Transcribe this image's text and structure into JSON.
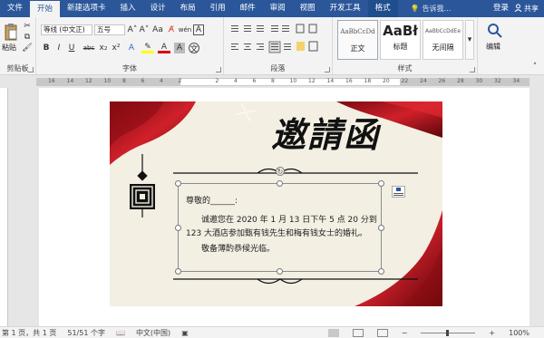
{
  "tabs": [
    "文件",
    "开始",
    "新建选项卡",
    "插入",
    "设计",
    "布局",
    "引用",
    "邮件",
    "审阅",
    "视图",
    "开发工具",
    "格式"
  ],
  "tellme": "告诉我...",
  "login": "登录",
  "share": "共享",
  "clipboard": {
    "paste": "粘贴",
    "label": "剪贴板"
  },
  "font": {
    "name": "等线 (中文正)",
    "size": "五号",
    "label": "字体",
    "bold": "B",
    "italic": "I",
    "underline": "U",
    "strike": "abc",
    "sub": "x₂",
    "sup": "x²",
    "wen": "文",
    "A_char": "A",
    "grow": "A˄",
    "shrink": "A˅",
    "aa": "Aa",
    "wen2": "wén"
  },
  "paragraph": {
    "label": "段落"
  },
  "styles": {
    "label": "样式",
    "items": [
      {
        "preview": "AaBbCcDd",
        "name": "正文"
      },
      {
        "preview": "AaBł",
        "name": "标题"
      },
      {
        "preview": "AaBbCcDdEe",
        "name": "无间隔"
      }
    ]
  },
  "editing": {
    "label": "编辑"
  },
  "ruler_ticks": [
    "16",
    "14",
    "12",
    "10",
    "8",
    "6",
    "4",
    "2",
    "",
    "2",
    "4",
    "6",
    "8",
    "10",
    "12",
    "14",
    "16",
    "18",
    "20",
    "22",
    "24",
    "26",
    "28",
    "30",
    "32",
    "34"
  ],
  "invitation": {
    "title": "邀請函",
    "salutation": "尊敬的______:",
    "line1": "诚邀您在 2020 年 1 月 13 日下午 5 点 20 分到",
    "line2": "123 大酒店参加甄有钱先生和梅有钱女士的婚礼。",
    "line3": "敬备薄酌恭候光临。"
  },
  "status": {
    "page": "第 1 页，共 1 页",
    "words": "51/51 个字",
    "lang": "中文(中国)",
    "zoom": "100%"
  },
  "colors": {
    "accent": "#2b579a",
    "ribbon": "#f3f3f3",
    "card": "#f3efe3",
    "red": "#b0141c"
  }
}
